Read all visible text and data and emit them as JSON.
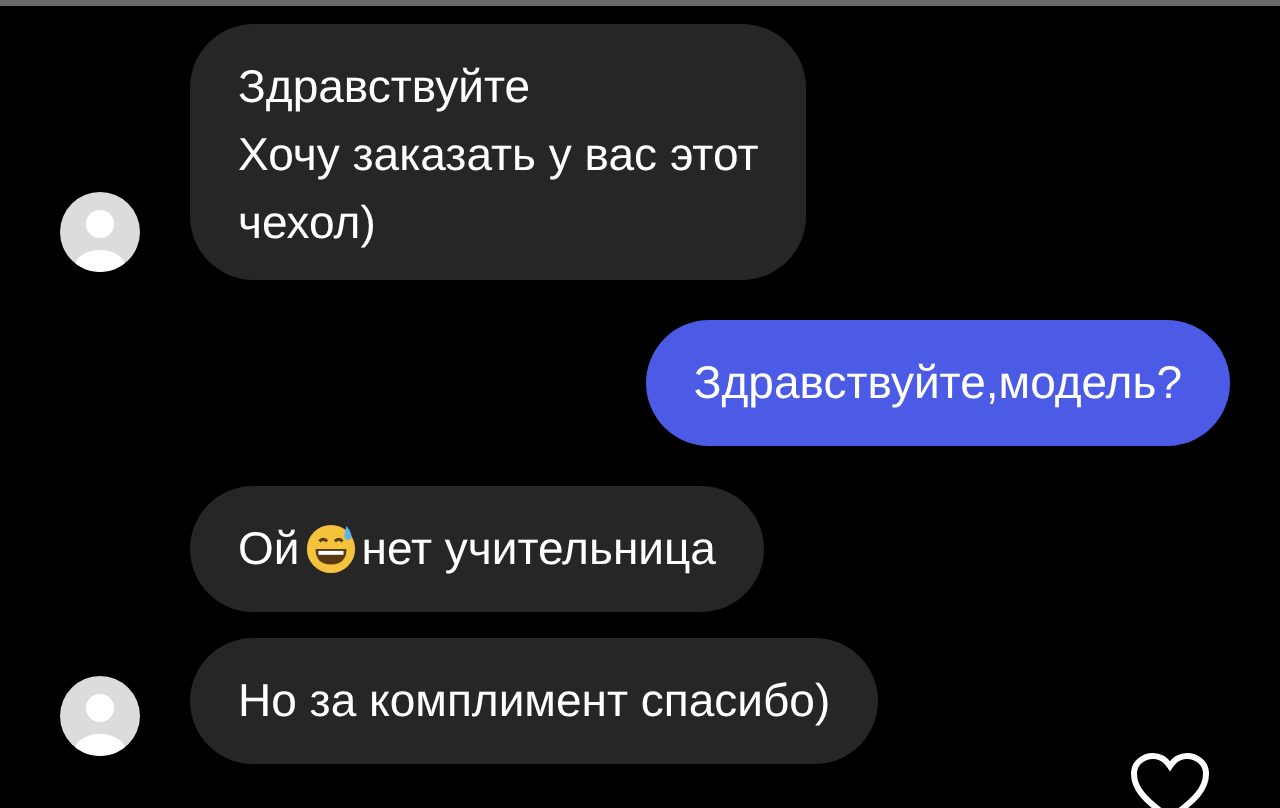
{
  "groups": [
    {
      "kind": "incoming",
      "bubbles": [
        {
          "kind": "text",
          "lines": [
            "Здравствуйте",
            "Хочу заказать у вас этот",
            "чехол)"
          ]
        }
      ]
    },
    {
      "kind": "outgoing",
      "bubbles": [
        {
          "kind": "text",
          "lines": [
            "Здравствуйте,модель?"
          ]
        }
      ]
    },
    {
      "kind": "incoming",
      "bubbles": [
        {
          "kind": "emoji",
          "before": "Ой",
          "after": "нет учительница"
        },
        {
          "kind": "text",
          "lines": [
            "Но за комплимент спасибо)"
          ]
        }
      ]
    }
  ],
  "liked": false
}
